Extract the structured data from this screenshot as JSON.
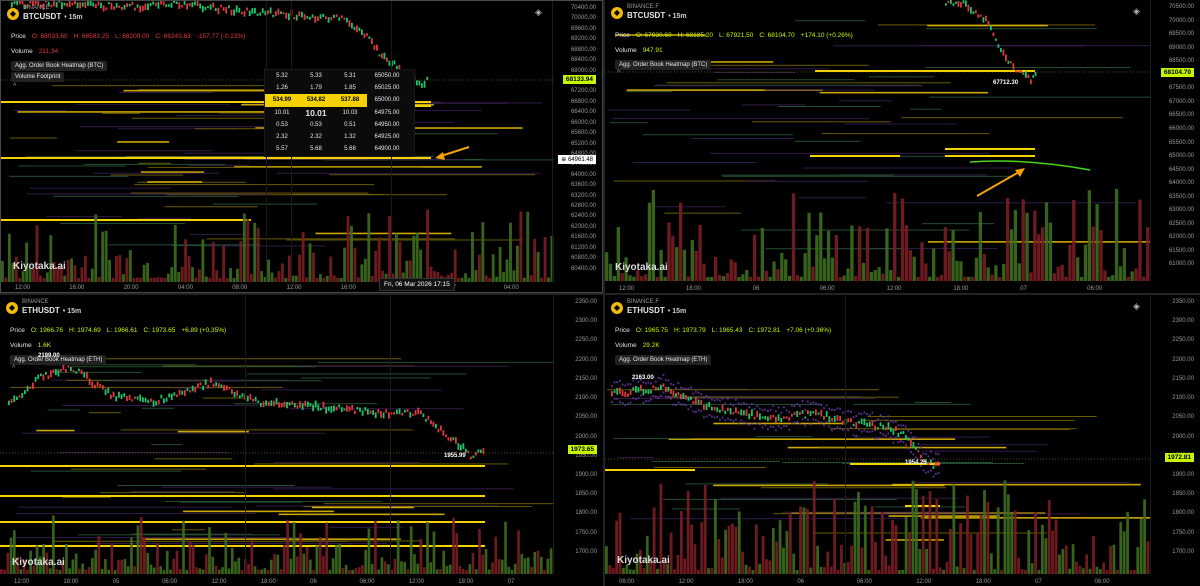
{
  "colors": {
    "up": "#20c26a",
    "down": "#e0383e",
    "accent": "#c6f500",
    "level": "#f0c400",
    "arrow": "#f5a300",
    "annotation": "#49d21e"
  },
  "panels": [
    {
      "exchange": "BINANCE",
      "symbol": "BTCUSDT",
      "timeframe": "15m",
      "price_label": "Price",
      "ohlc": {
        "o": "O: 68033.60",
        "h": "H: 68583.25",
        "l": "L: 68200.00",
        "c": "C: 68243.63",
        "chg": "-157.77 (-0.23%)"
      },
      "volume_label": "Volume",
      "volume_value": "211.34",
      "indicators": [
        "Agg. Order Book Heatmap (BTC)",
        "Volume Footprint"
      ],
      "price_tag": "68133.94",
      "level_tag": "64961.48",
      "y_ticks": [
        "70400.00",
        "70000.00",
        "69600.00",
        "69200.00",
        "68800.00",
        "68400.00",
        "68000.00",
        "67600.00",
        "67200.00",
        "66800.00",
        "66400.00",
        "66000.00",
        "65600.00",
        "65200.00",
        "64800.00",
        "64400.00",
        "64000.00",
        "63600.00",
        "63200.00",
        "62800.00",
        "62400.00",
        "62000.00",
        "61600.00",
        "61200.00",
        "60800.00",
        "60400.00"
      ],
      "x_ticks": [
        "12:00",
        "16:00",
        "20:00",
        "04:00",
        "08:00",
        "12:00",
        "16:00",
        "20:00",
        "07",
        "04:00"
      ],
      "crosshair_label": "Fri, 06 Mar 2026 17:15",
      "dom": {
        "rows": [
          [
            "5.32",
            "5.33",
            "5.31",
            "65050.00"
          ],
          [
            "1.26",
            "1.79",
            "1.85",
            "65025.00"
          ],
          [
            "534.99",
            "534.82",
            "537.88",
            "65000.00"
          ],
          [
            "10.01",
            "10.01",
            "10.03",
            "64975.00"
          ],
          [
            "0.53",
            "0.53",
            "0.51",
            "64950.00"
          ],
          [
            "2.32",
            "2.32",
            "1.32",
            "64925.00"
          ],
          [
            "5.57",
            "5.68",
            "5.68",
            "64900.00"
          ]
        ]
      },
      "watermark": "Kiyotaka.ai"
    },
    {
      "exchange": "BINANCE.F",
      "symbol": "BTCUSDT",
      "timeframe": "15m",
      "price_label": "Price",
      "ohlc": {
        "o": "O: 67930.60",
        "h": "H: 68185.20",
        "l": "L: 67921.50",
        "c": "C: 68104.70",
        "chg": "+174.10 (+0.26%)"
      },
      "volume_label": "Volume",
      "volume_value": "947.91",
      "indicators": [
        "Agg. Order Book Heatmap (BTC)"
      ],
      "price_tag": "68104.70",
      "low_label": "67712.30",
      "y_ticks": [
        "70500.00",
        "70000.00",
        "69500.00",
        "69000.00",
        "68500.00",
        "68000.00",
        "67500.00",
        "67000.00",
        "66500.00",
        "66000.00",
        "65500.00",
        "65000.00",
        "64500.00",
        "64000.00",
        "63500.00",
        "63000.00",
        "62500.00",
        "62000.00",
        "61500.00",
        "61000.00"
      ],
      "x_ticks": [
        "12:00",
        "18:00",
        "06",
        "06:00",
        "12:00",
        "18:00",
        "07",
        "06:00"
      ],
      "watermark": "Kiyotaka.ai"
    },
    {
      "exchange": "BINANCE",
      "symbol": "ETHUSDT",
      "timeframe": "15m",
      "price_label": "Price",
      "ohlc": {
        "o": "O: 1966.76",
        "h": "H: 1974.69",
        "l": "L: 1966.61",
        "c": "C: 1973.65",
        "chg": "+6.89 (+0.35%)"
      },
      "volume_label": "Volume",
      "volume_value": "1.6K",
      "indicators": [
        "Agg. Order Book Heatmap (ETH)"
      ],
      "price_tag": "1973.65",
      "high_label": "2199.00",
      "low_label": "1955.99",
      "y_ticks": [
        "2350.00",
        "2300.00",
        "2250.00",
        "2200.00",
        "2150.00",
        "2100.00",
        "2050.00",
        "2000.00",
        "1950.00",
        "1900.00",
        "1850.00",
        "1800.00",
        "1750.00",
        "1700.00"
      ],
      "x_ticks": [
        "12:00",
        "18:00",
        "05",
        "06:00",
        "12:00",
        "18:00",
        "06",
        "06:00",
        "12:00",
        "18:00",
        "07"
      ],
      "watermark": "Kiyotaka.ai"
    },
    {
      "exchange": "BINANCE.F",
      "symbol": "ETHUSDT",
      "timeframe": "15m",
      "price_label": "Price",
      "ohlc": {
        "o": "O: 1965.75",
        "h": "H: 1973.79",
        "l": "L: 1965.43",
        "c": "C: 1972.81",
        "chg": "+7.06 (+0.36%)"
      },
      "volume_label": "Volume",
      "volume_value": "29.2K",
      "indicators": [
        "Agg. Order Book Heatmap (ETH)"
      ],
      "price_tag": "1972.81",
      "high_label": "2163.00",
      "low_label": "1954.25",
      "y_ticks": [
        "2350.00",
        "2300.00",
        "2250.00",
        "2200.00",
        "2150.00",
        "2100.00",
        "2050.00",
        "2000.00",
        "1950.00",
        "1900.00",
        "1850.00",
        "1800.00",
        "1750.00",
        "1700.00"
      ],
      "x_ticks": [
        "06:00",
        "12:00",
        "18:00",
        "06",
        "06:00",
        "12:00",
        "18:00",
        "07",
        "06:00"
      ],
      "watermark": "Kiyotaka.ai"
    }
  ]
}
